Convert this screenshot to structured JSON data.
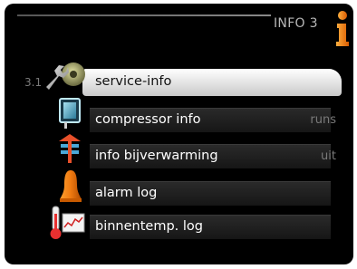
{
  "header": {
    "title": "INFO  3"
  },
  "menu": {
    "selected_number": "3.1",
    "items": [
      {
        "label": "service-info",
        "value": "",
        "icon": "tools-icon"
      },
      {
        "label": "compressor info",
        "value": "runs",
        "icon": "compressor-icon"
      },
      {
        "label": "info bijverwarming",
        "value": "uit",
        "icon": "heater-icon"
      },
      {
        "label": "alarm log",
        "value": "",
        "icon": "bell-icon"
      },
      {
        "label": "binnentemp. log",
        "value": "",
        "icon": "thermometer-chart-icon"
      }
    ]
  },
  "colors": {
    "accent_orange": "#f07a10",
    "background": "#000000",
    "selected_bg": "#ffffff"
  }
}
